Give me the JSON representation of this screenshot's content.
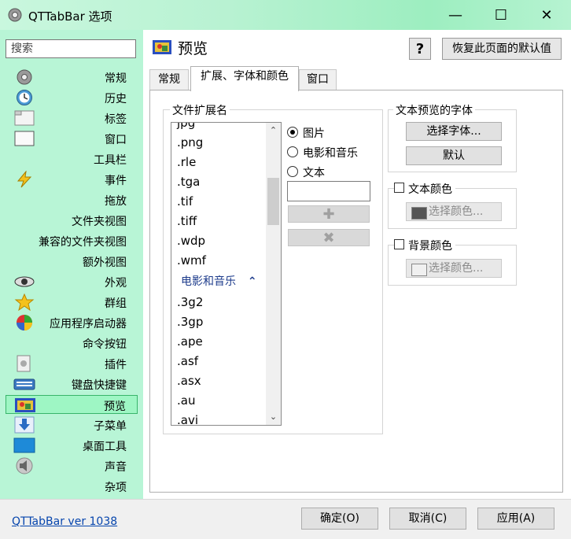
{
  "window": {
    "title": "QTTabBar 选项",
    "minimize": "—",
    "maximize": "☐",
    "close": "✕"
  },
  "sidebar": {
    "search_placeholder": "搜索",
    "items": [
      {
        "label": "常规",
        "icon": "gear-icon"
      },
      {
        "label": "历史",
        "icon": "history-clock-icon"
      },
      {
        "label": "标签",
        "icon": "tab-icon"
      },
      {
        "label": "窗口",
        "icon": "window-icon"
      },
      {
        "label": "工具栏",
        "icon": ""
      },
      {
        "label": "事件",
        "icon": "lightning-icon"
      },
      {
        "label": "拖放",
        "icon": ""
      },
      {
        "label": "文件夹视图",
        "icon": ""
      },
      {
        "label": "兼容的文件夹视图",
        "icon": ""
      },
      {
        "label": "额外视图",
        "icon": ""
      },
      {
        "label": "外观",
        "icon": "eye-icon"
      },
      {
        "label": "群组",
        "icon": "star-icon"
      },
      {
        "label": "应用程序启动器",
        "icon": "app-launcher-icon"
      },
      {
        "label": "命令按钮",
        "icon": ""
      },
      {
        "label": "插件",
        "icon": "plugin-icon"
      },
      {
        "label": "键盘快捷键",
        "icon": "keyboard-icon"
      },
      {
        "label": "预览",
        "icon": "preview-image-icon",
        "selected": true
      },
      {
        "label": "子菜单",
        "icon": "down-arrow-icon"
      },
      {
        "label": "桌面工具",
        "icon": "desktop-icon"
      },
      {
        "label": "声音",
        "icon": "speaker-icon"
      },
      {
        "label": "杂项",
        "icon": ""
      }
    ]
  },
  "main": {
    "title": "预览",
    "help_label": "?",
    "reset_label": "恢复此页面的默认值",
    "tabs": [
      {
        "label": "常规",
        "active": false
      },
      {
        "label": "扩展、字体和颜色",
        "active": true
      },
      {
        "label": "窗口",
        "active": false
      }
    ],
    "ext_group_title": "文件扩展名",
    "ext_list_top": [
      "jpg",
      ".png",
      ".rle",
      ".tga",
      ".tif",
      ".tiff",
      ".wdp",
      ".wmf"
    ],
    "ext_group_header": "电影和音乐",
    "ext_list_bottom": [
      ".3g2",
      ".3gp",
      ".ape",
      ".asf",
      ".asx",
      ".au",
      ".avi"
    ],
    "radios": [
      {
        "label": "图片",
        "checked": true
      },
      {
        "label": "电影和音乐",
        "checked": false
      },
      {
        "label": "文本",
        "checked": false
      }
    ],
    "add_glyph": "✚",
    "remove_glyph": "✖",
    "font_group_title": "文本预览的字体",
    "choose_font_label": "选择字体...",
    "default_label": "默认",
    "text_color_label": "文本颜色",
    "choose_color_label": "选择颜色...",
    "bg_color_label": "背景颜色",
    "choose_color_label2": "选择颜色...",
    "text_color_swatch": "#555555",
    "bg_color_swatch": "#f0f0f0"
  },
  "footer": {
    "version_link": "QTTabBar ver 1038",
    "ok_label": "确定(O)",
    "cancel_label": "取消(C)",
    "apply_label": "应用(A)"
  }
}
